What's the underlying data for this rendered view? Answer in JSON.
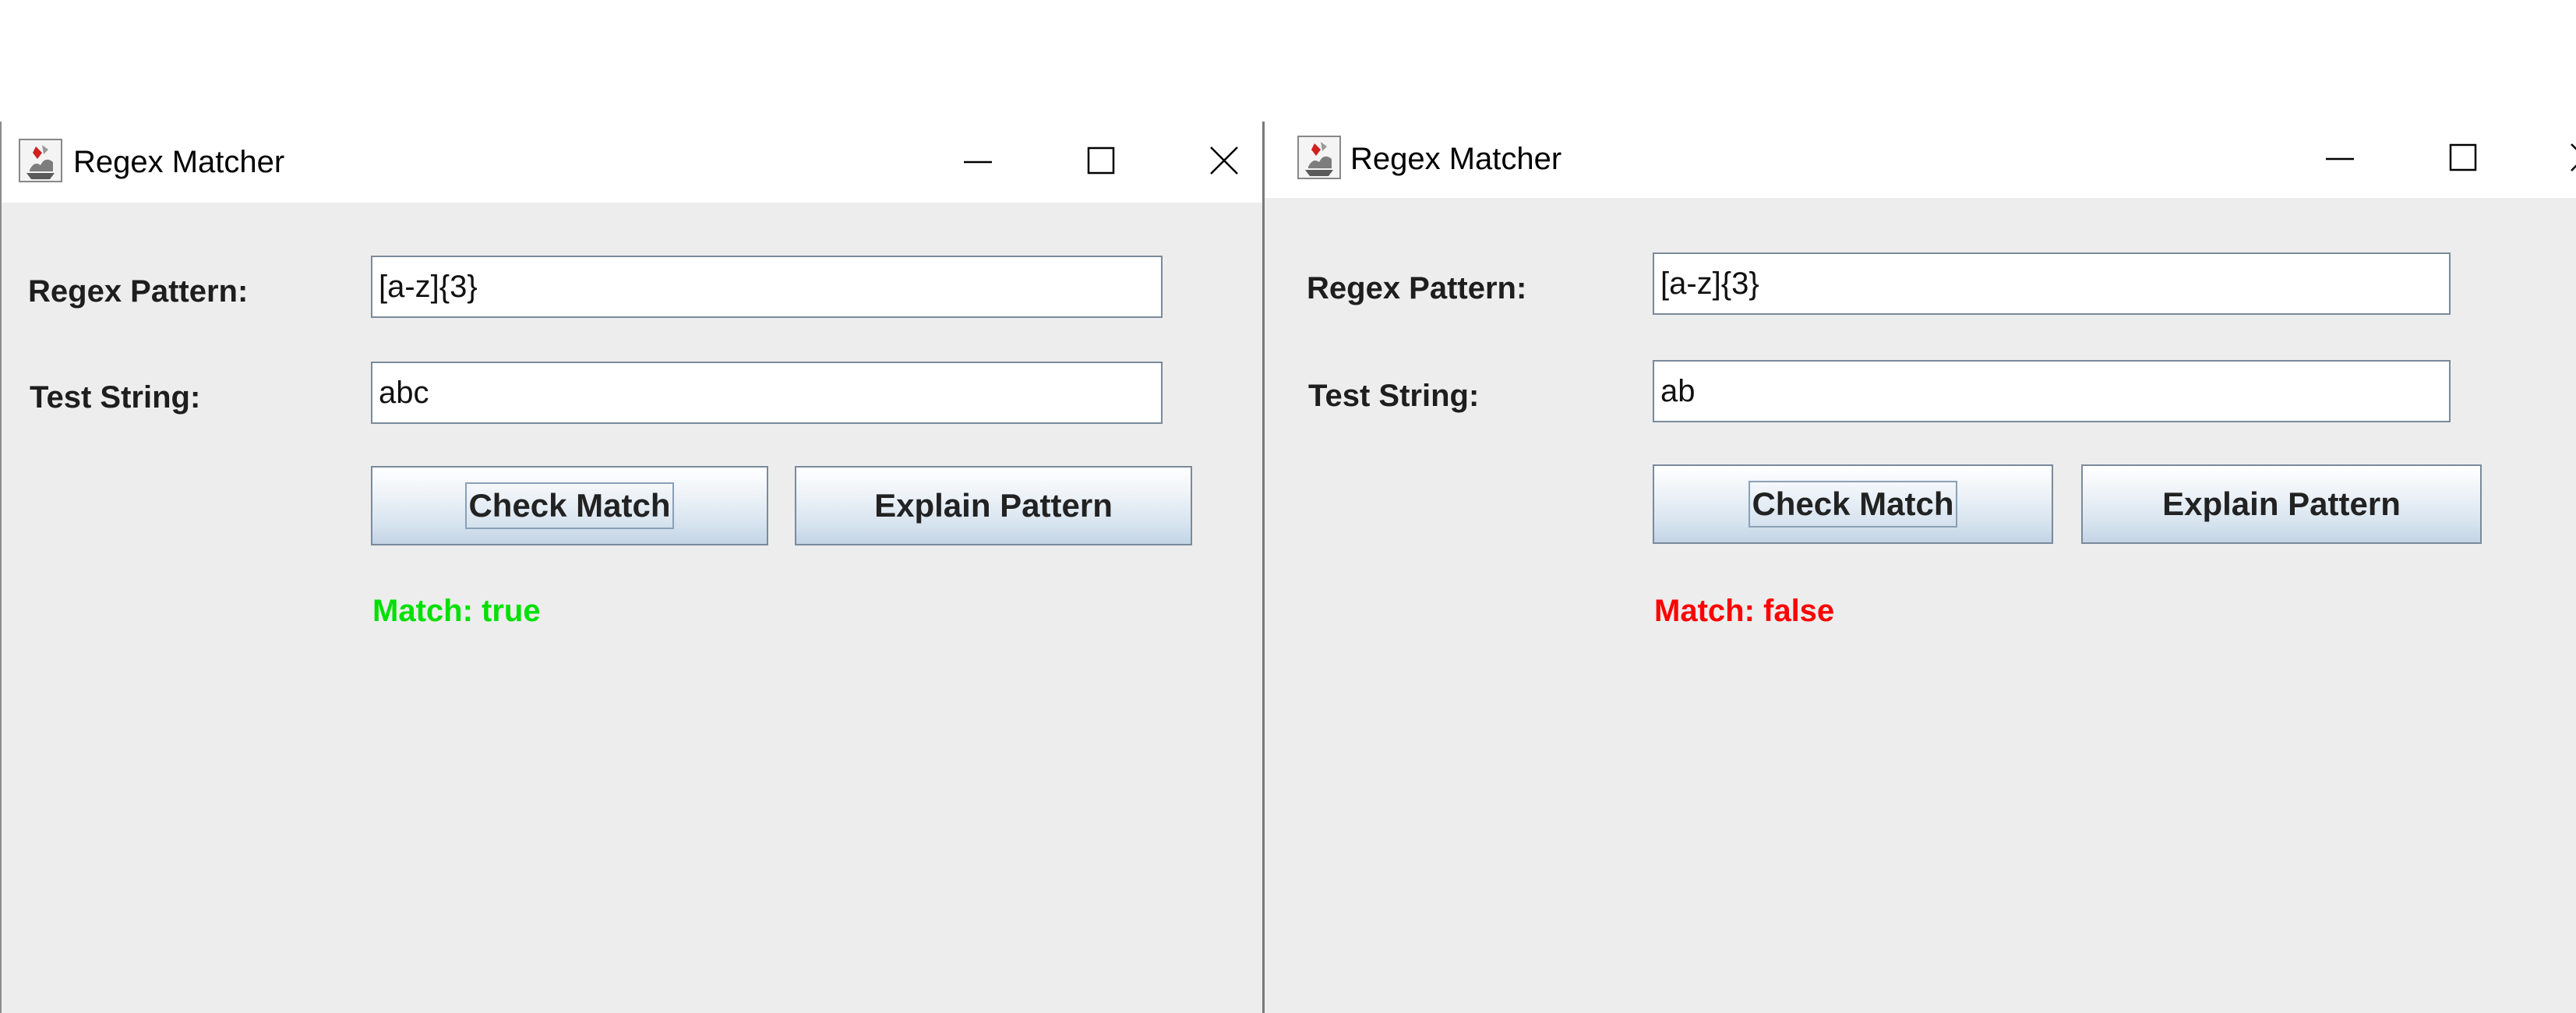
{
  "colors": {
    "match_true": "#00e000",
    "match_false": "#ff0000"
  },
  "windows": [
    {
      "title": "Regex Matcher",
      "app_icon": "java-coffee-icon",
      "pattern_label": "Regex Pattern:",
      "pattern_value": "[a-z]{3}",
      "test_label": "Test String:",
      "test_value": "abc",
      "check_label": "Check Match",
      "explain_label": "Explain Pattern",
      "status_text": "Match: true"
    },
    {
      "title": "Regex Matcher",
      "app_icon": "java-coffee-icon",
      "pattern_label": "Regex Pattern:",
      "pattern_value": "[a-z]{3}",
      "test_label": "Test String:",
      "test_value": "ab",
      "check_label": "Check Match",
      "explain_label": "Explain Pattern",
      "status_text": "Match: false"
    }
  ],
  "window_controls": {
    "minimize_icon": "minimize-icon",
    "maximize_icon": "maximize-icon",
    "close_icon": "close-icon"
  }
}
